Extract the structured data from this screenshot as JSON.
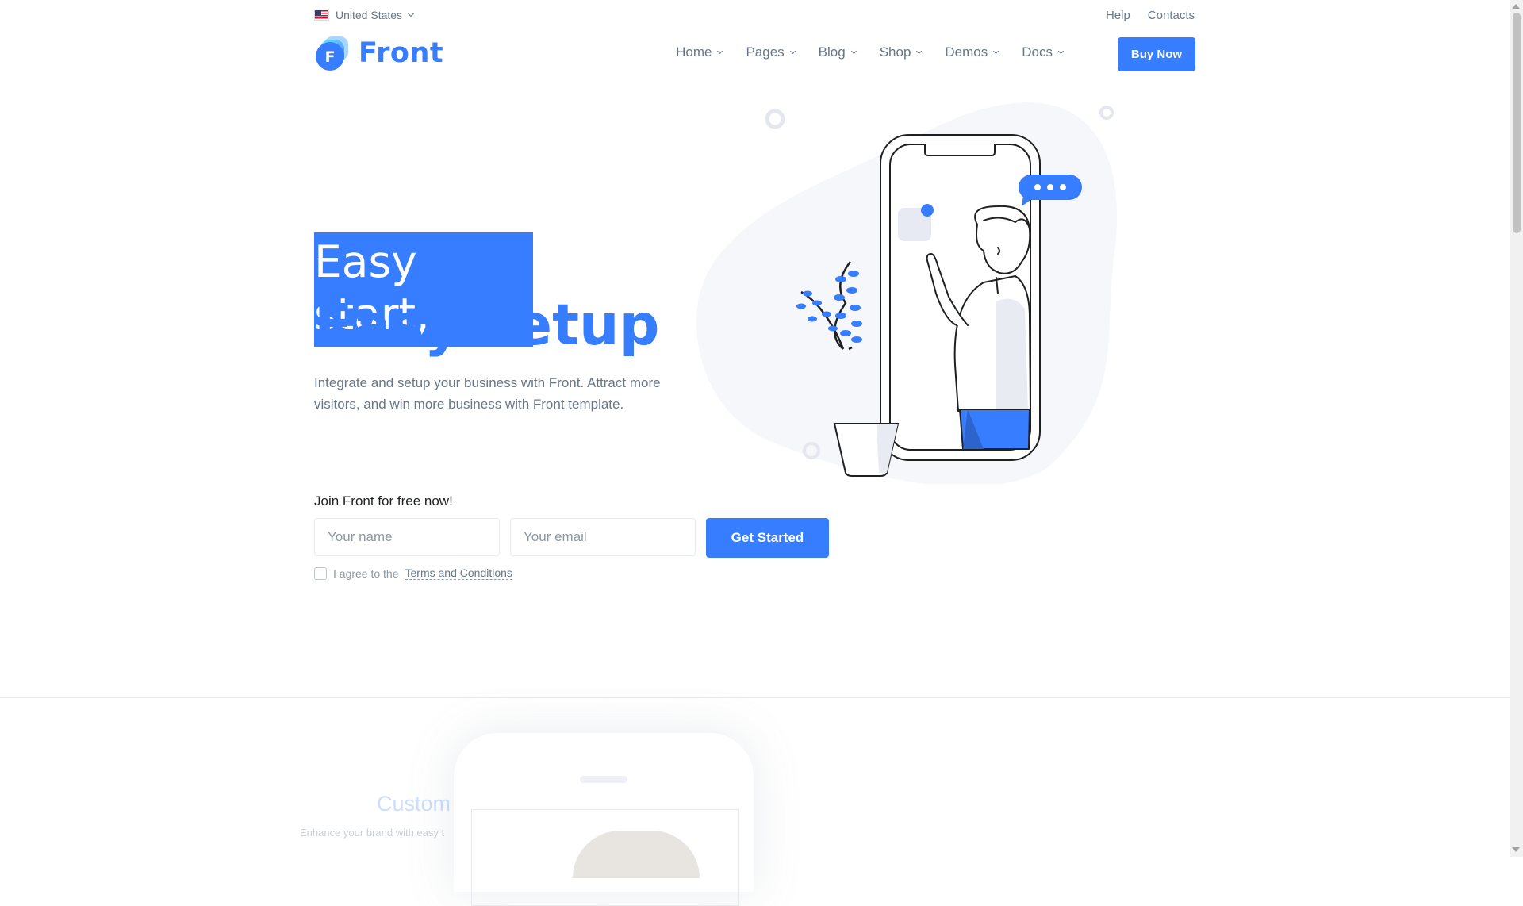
{
  "topbar": {
    "region": "United States",
    "links": [
      "Help",
      "Contacts"
    ]
  },
  "header": {
    "logo_text": "Front",
    "logo_letter": "F",
    "nav": [
      "Home",
      "Pages",
      "Blog",
      "Shop",
      "Demos",
      "Docs"
    ],
    "buy_button": "Buy Now"
  },
  "hero": {
    "title_line1": "Easy start,",
    "title_line2": "Easy setup",
    "lead": "Integrate and setup your business with Front. Attract more visitors, and win more business with Front template.",
    "join_label": "Join Front for free now!",
    "name_placeholder": "Your name",
    "email_placeholder": "Your email",
    "cta": "Get Started",
    "agree_text": "I agree to the",
    "terms_link": "Terms and Conditions"
  },
  "next_section": {
    "title": "Custom",
    "subtitle": "Enhance your brand with easy t"
  },
  "colors": {
    "primary": "#377dff",
    "text": "#677788",
    "border": "#e7eaf3"
  }
}
